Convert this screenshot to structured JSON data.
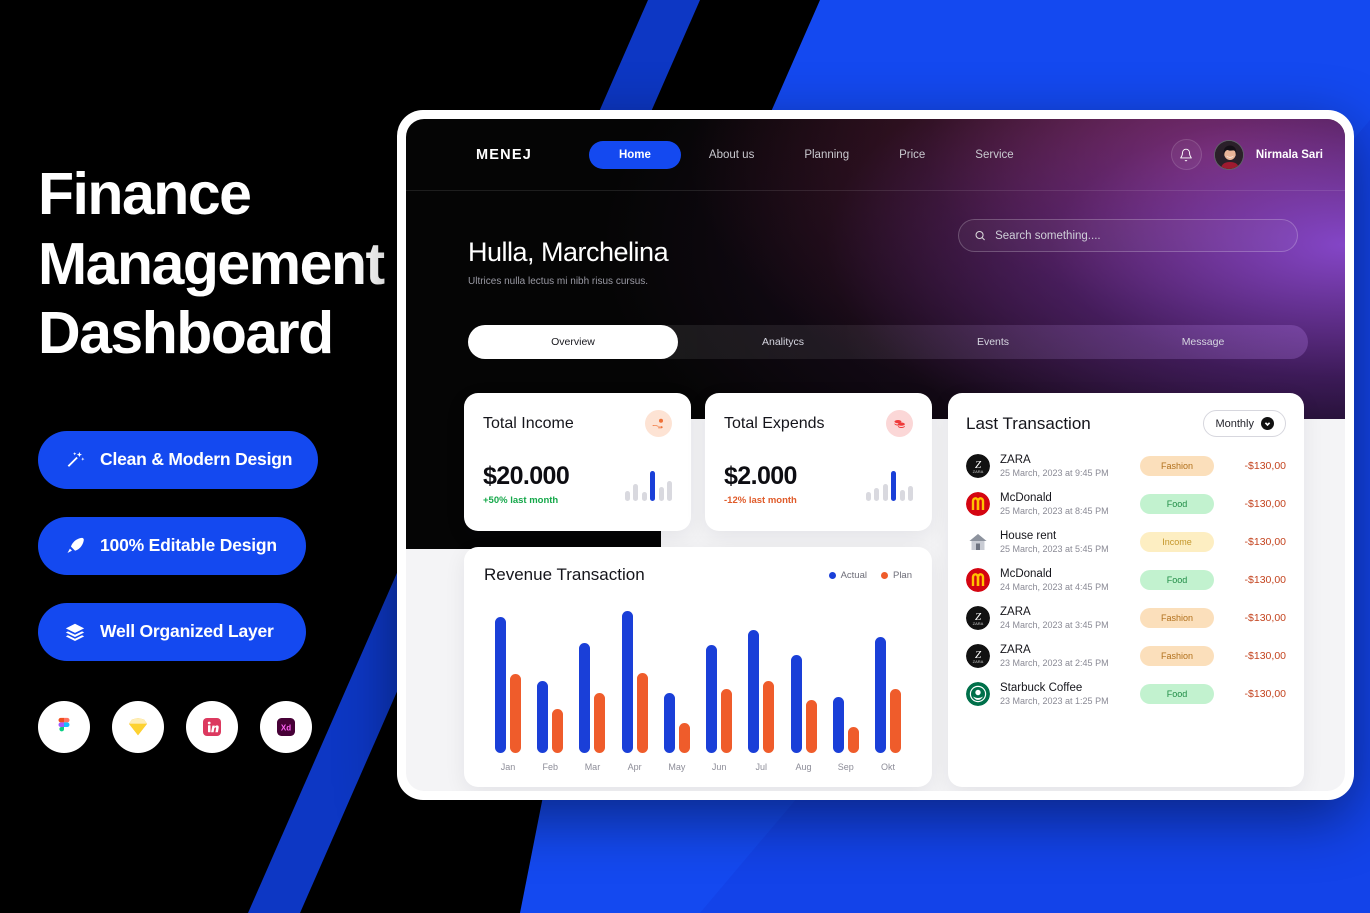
{
  "promo": {
    "title_lines": [
      "Finance",
      "Management",
      "Dashboard"
    ],
    "features": [
      {
        "label": "Clean & Modern  Design",
        "icon": "magic-wand-icon"
      },
      {
        "label": "100% Editable Design",
        "icon": "pen-nib-icon"
      },
      {
        "label": "Well Organized Layer",
        "icon": "layers-icon"
      }
    ],
    "apps": [
      {
        "name": "figma-logo"
      },
      {
        "name": "sketch-logo"
      },
      {
        "name": "invision-logo"
      },
      {
        "name": "adobe-xd-logo"
      }
    ]
  },
  "dashboard": {
    "brand": "MENEJ",
    "nav": [
      {
        "label": "Home",
        "active": true
      },
      {
        "label": "About us",
        "active": false
      },
      {
        "label": "Planning",
        "active": false
      },
      {
        "label": "Price",
        "active": false
      },
      {
        "label": "Service",
        "active": false
      }
    ],
    "user": {
      "name": "Nirmala Sari"
    },
    "greeting": {
      "title": "Hulla, Marchelina",
      "subtitle": "Ultrices nulla lectus mi nibh risus cursus."
    },
    "search": {
      "placeholder": "Search something....",
      "value": ""
    },
    "tabs": [
      {
        "label": "Overview",
        "active": true
      },
      {
        "label": "Analitycs",
        "active": false
      },
      {
        "label": "Events",
        "active": false
      },
      {
        "label": "Message",
        "active": false
      }
    ],
    "stats": [
      {
        "title": "Total Income",
        "value": "$20.000",
        "delta": "+50% last month",
        "direction": "up",
        "icon": "income-hand-coin-icon"
      },
      {
        "title": "Total Expends",
        "value": "$2.000",
        "delta": "-12% last month",
        "direction": "down",
        "icon": "expense-coins-icon"
      }
    ],
    "revenue": {
      "title": "Revenue Transaction",
      "legend": [
        {
          "label": "Actual",
          "color": "#1a3fd8"
        },
        {
          "label": "Plan",
          "color": "#ef5c2b"
        }
      ]
    },
    "transactions": {
      "title": "Last Transaction",
      "filter_label": "Monthly",
      "rows": [
        {
          "name": "ZARA",
          "date": "25 March, 2023 at 9:45 PM",
          "chip": "Fashion",
          "chip_type": "fashion",
          "amount": "-$130,00",
          "logo": "zara-logo"
        },
        {
          "name": "McDonald",
          "date": "25 March, 2023 at 8:45 PM",
          "chip": "Food",
          "chip_type": "food",
          "amount": "-$130,00",
          "logo": "mcdonalds-logo"
        },
        {
          "name": "House rent",
          "date": "25 March, 2023 at 5:45 PM",
          "chip": "Income",
          "chip_type": "income",
          "amount": "-$130,00",
          "logo": "house-icon"
        },
        {
          "name": "McDonald",
          "date": "24 March, 2023 at 4:45 PM",
          "chip": "Food",
          "chip_type": "food",
          "amount": "-$130,00",
          "logo": "mcdonalds-logo"
        },
        {
          "name": "ZARA",
          "date": "24 March, 2023 at 3:45 PM",
          "chip": "Fashion",
          "chip_type": "fashion",
          "amount": "-$130,00",
          "logo": "zara-logo"
        },
        {
          "name": "ZARA",
          "date": "23 March, 2023 at 2:45 PM",
          "chip": "Fashion",
          "chip_type": "fashion",
          "amount": "-$130,00",
          "logo": "zara-logo"
        },
        {
          "name": "Starbuck Coffee",
          "date": "23 March, 2023 at 1:25 PM",
          "chip": "Food",
          "chip_type": "food",
          "amount": "-$130,00",
          "logo": "starbucks-logo"
        }
      ]
    }
  },
  "colors": {
    "accent_blue": "#1449f0",
    "chart_actual": "#1a3fd8",
    "chart_plan": "#ef5c2b",
    "positive": "#15a84a",
    "negative": "#e05b2a",
    "background": "#000000"
  },
  "chart_data": {
    "type": "bar",
    "title": "Revenue Transaction",
    "categories": [
      "Jan",
      "Feb",
      "Mar",
      "Apr",
      "May",
      "Jun",
      "Jul",
      "Aug",
      "Sep",
      "Okt"
    ],
    "series": [
      {
        "name": "Actual",
        "color": "#1a3fd8",
        "values": [
          100,
          53,
          81,
          104,
          44,
          79,
          90,
          72,
          41,
          85
        ]
      },
      {
        "name": "Plan",
        "color": "#ef5c2b",
        "values": [
          58,
          32,
          44,
          59,
          22,
          47,
          53,
          39,
          19,
          47
        ]
      }
    ],
    "xlabel": "",
    "ylabel": "",
    "ylim": [
      0,
      110
    ],
    "grid": false,
    "legend_position": "top-right"
  },
  "sparklines": {
    "income": {
      "values": [
        10,
        17,
        9,
        30,
        14,
        20
      ],
      "highlight_index": 3
    },
    "expends": {
      "values": [
        9,
        13,
        17,
        30,
        11,
        15
      ],
      "highlight_index": 3
    }
  }
}
